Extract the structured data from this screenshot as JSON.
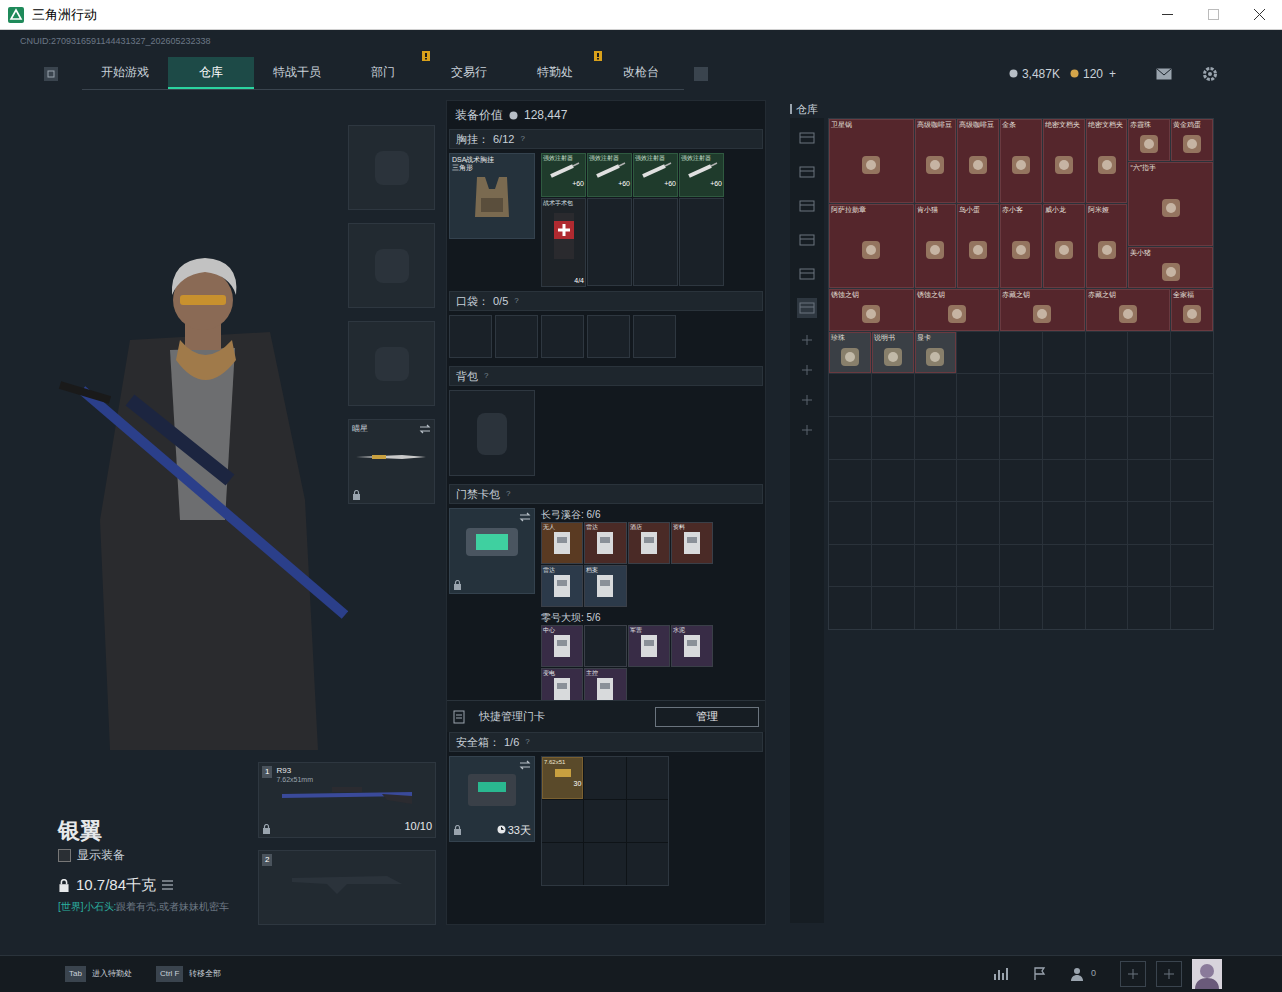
{
  "window": {
    "title": "三角洲行动"
  },
  "header": {
    "uid": "CNUID:2709316591144431327_202605232338",
    "tabs": [
      {
        "label": "开始游戏",
        "selected": false,
        "alert": false
      },
      {
        "label": "仓库",
        "selected": true,
        "alert": false
      },
      {
        "label": "特战干员",
        "selected": false,
        "alert": false
      },
      {
        "label": "部门",
        "selected": false,
        "alert": true
      },
      {
        "label": "交易行",
        "selected": false,
        "alert": false
      },
      {
        "label": "特勤处",
        "selected": false,
        "alert": true
      },
      {
        "label": "改枪台",
        "selected": false,
        "alert": false
      }
    ],
    "currency": [
      {
        "value": "3,487K"
      },
      {
        "value": "120",
        "action": "+"
      }
    ]
  },
  "loadout": {
    "value_label": "装备价值",
    "value": "128,447",
    "chest": {
      "label": "胸挂：",
      "count": "6/12",
      "help": "?",
      "rig": {
        "name": "DSA战术胸挂",
        "sub": "三角形"
      },
      "items": [
        {
          "name": "强效注射器",
          "value": "+60"
        },
        {
          "name": "强效注射器",
          "value": "+60"
        },
        {
          "name": "强效注射器",
          "value": "+60"
        },
        {
          "name": "强效注射器",
          "value": "+60"
        }
      ],
      "medkit": {
        "name": "战术手术包",
        "count": "4/4"
      }
    },
    "pocket": {
      "label": "口袋：",
      "count": "0/5",
      "help": "?"
    },
    "backpack": {
      "label": "背包",
      "help": "?"
    },
    "keycards": {
      "label": "门禁卡包",
      "help": "?",
      "maps": [
        {
          "title": "长弓溪谷: 6/6",
          "cards": [
            {
              "filled": true,
              "name": "无人",
              "color": "#5a3a22"
            },
            {
              "filled": true,
              "name": "雷达",
              "color": "#4a2a26"
            },
            {
              "filled": true,
              "name": "酒店",
              "color": "#4a2a26"
            },
            {
              "filled": true,
              "name": "资料",
              "color": "#4a2a26"
            },
            {
              "filled": true,
              "name": "雷达",
              "color": "#2c3a4a"
            },
            {
              "filled": true,
              "name": "档案",
              "color": "#2c3a4a"
            }
          ]
        },
        {
          "title": "零号大坝: 5/6",
          "cards": [
            {
              "filled": true,
              "name": "中心",
              "color": "#382c46"
            },
            {
              "filled": false
            },
            {
              "filled": true,
              "name": "军营",
              "color": "#382c46"
            },
            {
              "filled": true,
              "name": "水泥",
              "color": "#382c46"
            },
            {
              "filled": true,
              "name": "变电",
              "color": "#382c46"
            },
            {
              "filled": true,
              "name": "主控",
              "color": "#382c46"
            }
          ]
        }
      ],
      "manage_label": "快捷管理门卡",
      "manage_button": "管理"
    },
    "safebox": {
      "label": "安全箱：",
      "count": "1/6",
      "help": "?",
      "days": "33天",
      "item": {
        "name": "7.62x51",
        "count": "30"
      }
    }
  },
  "melee": {
    "name": "瞄星"
  },
  "weapons": [
    {
      "slot": "1",
      "name": "R93",
      "ammo_type": "7.62x51mm",
      "ammo": "10/10"
    },
    {
      "slot": "2"
    }
  ],
  "operator": {
    "name": "银翼",
    "show_equipment_label": "显示装备",
    "show_equipment": false,
    "weight": "10.7/84千克",
    "chat_channel": "[世界]小石头:",
    "chat_message": "跟着有壳,或者妹妹机密车"
  },
  "warehouse": {
    "title": "仓库",
    "items": [
      {
        "name": "卫星锅",
        "color": "#55262c"
      },
      {
        "name": "高级咖啡豆",
        "color": "#55262c"
      },
      {
        "name": "高级咖啡豆",
        "color": "#55262c"
      },
      {
        "name": "金条",
        "color": "#55262c"
      },
      {
        "name": "绝密文档夹",
        "color": "#55262c"
      },
      {
        "name": "绝密文档夹",
        "color": "#55262c"
      },
      {
        "name": "赤霞珠",
        "color": "#55262c"
      },
      {
        "name": "黄金鸡蛋",
        "color": "#55262c"
      },
      {
        "name": "“六”指手",
        "color": "#55262c"
      },
      {
        "name": "阿萨拉勋章",
        "color": "#55262c"
      },
      {
        "name": "肯小猫",
        "color": "#55262c"
      },
      {
        "name": "鸟小蛋",
        "color": "#55262c"
      },
      {
        "name": "赤小客",
        "color": "#55262c"
      },
      {
        "name": "威小龙",
        "color": "#55262c"
      },
      {
        "name": "阿米娅",
        "color": "#55262c"
      },
      {
        "name": "美小猪",
        "color": "#55262c"
      },
      {
        "name": "锈蚀之钥",
        "color": "#55262c"
      },
      {
        "name": "锈蚀之钥",
        "color": "#55262c"
      },
      {
        "name": "赤藏之钥",
        "color": "#55262c"
      },
      {
        "name": "赤藏之钥",
        "color": "#55262c"
      },
      {
        "name": "全家福",
        "color": "#55262c"
      },
      {
        "name": "珍珠",
        "color": "#3a3f45"
      },
      {
        "name": "说明书",
        "color": "#3a3f45"
      },
      {
        "name": "显卡",
        "color": "#3a3f45"
      }
    ]
  },
  "bottom": {
    "keys": [
      {
        "key": "Tab",
        "label": "进入特勤处"
      },
      {
        "key": "Ctrl F",
        "label": "转移全部"
      }
    ],
    "friends": "0"
  }
}
